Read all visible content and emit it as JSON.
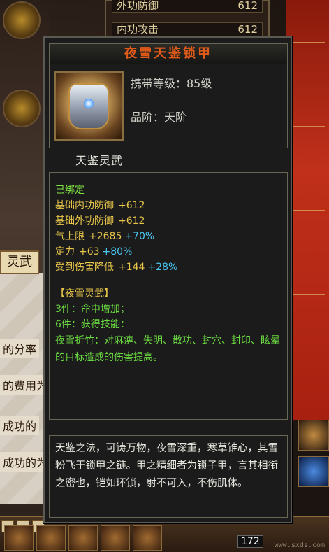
{
  "tooltip": {
    "title": "夜雪天鉴锁甲",
    "level_text": "携带等级：85级",
    "grade_text": "品阶：天阶",
    "subtitle": "天鉴灵武",
    "bound": "已绑定",
    "stats": [
      {
        "name": "基础内功防御",
        "value": "+612",
        "pct": ""
      },
      {
        "name": "基础外功防御",
        "value": "+612",
        "pct": ""
      },
      {
        "name": "气上限",
        "value": "+2685",
        "pct": "+70%"
      },
      {
        "name": "定力",
        "value": "+63",
        "pct": "+80%"
      },
      {
        "name": "受到伤害降低",
        "value": "+144",
        "pct": "+28%"
      }
    ],
    "set": {
      "title": "【夜雪灵武】",
      "piece3": "3件：命中增加；",
      "piece6": "6件：获得技能：",
      "skill": "夜雪折竹：对麻痹、失明、散功、封穴、封印、眩晕的目标造成的伤害提高。"
    },
    "description": "天鉴之法，可铸万物，夜雪深重，寒草锥心，其雪粉飞于锁甲之链。甲之精细者为锁子甲，言其相衔之密也，铠如环锁，射不可入，不伤肌体。"
  },
  "background": {
    "top_rows": [
      {
        "label": "外功防御",
        "value": "612"
      },
      {
        "label": "内功攻击",
        "value": "612"
      }
    ],
    "left_tab": "灵武",
    "left_texts": [
      "的分率",
      "的费用为",
      "成功的",
      "成功的为"
    ],
    "bottom_count": "172",
    "watermark": "www.sxds.com"
  },
  "colors": {
    "title": "#e05a1a",
    "stat": "#e8c64a",
    "percent": "#4ac8f0",
    "green": "#6ad840"
  }
}
